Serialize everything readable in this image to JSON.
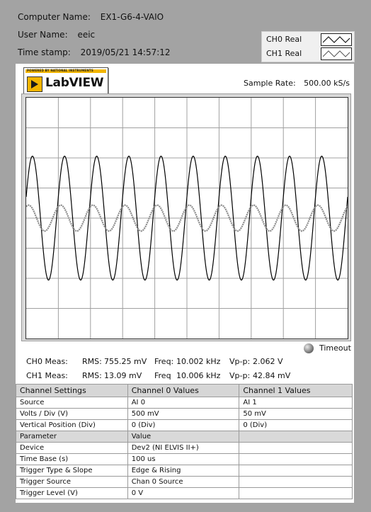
{
  "info": {
    "computer_label": "Computer Name:",
    "computer_value": "EX1-G6-4-VAIO",
    "user_label": "User Name:",
    "user_value": "eeic",
    "time_label": "Time stamp:",
    "time_value": "2019/05/21 14:57:12"
  },
  "legend": {
    "ch0": "CH0 Real",
    "ch1": "CH1 Real"
  },
  "logo": {
    "text": "LabVIEW",
    "powered": "POWERED BY NATIONAL INSTRUMENTS"
  },
  "sample_rate": {
    "label": "Sample Rate:",
    "value": "500.00 kS/s"
  },
  "timeout": {
    "label": "Timeout"
  },
  "measurements": [
    {
      "label": "CH0 Meas:",
      "rms_label": "RMS:",
      "rms": "755.25 mV",
      "freq_label": "Freq:",
      "freq": "10.002 kHz",
      "vpp_label": "Vp-p:",
      "vpp": "2.062 V"
    },
    {
      "label": "CH1 Meas:",
      "rms_label": "RMS:",
      "rms": "13.09 mV",
      "freq_label": "Freq",
      "freq": "10.006 kHz",
      "vpp_label": "Vp-p:",
      "vpp": "42.84 mV"
    }
  ],
  "table": {
    "headers": [
      "Channel Settings",
      "Channel 0 Values",
      "Channel 1 Values"
    ],
    "rows": [
      [
        "Source",
        "AI 0",
        "AI 1"
      ],
      [
        "Volts / Div (V)",
        "500 mV",
        "50 mV"
      ],
      [
        "Vertical Position (Div)",
        "0 (Div)",
        "0 (Div)"
      ]
    ],
    "sub_headers": [
      "Parameter",
      "Value",
      ""
    ],
    "param_rows": [
      [
        "Device",
        "Dev2 (NI ELVIS II+)",
        ""
      ],
      [
        "Time Base (s)",
        "100 us",
        ""
      ],
      [
        "Trigger Type & Slope",
        "Edge & Rising",
        ""
      ],
      [
        "Trigger Source",
        "Chan 0 Source",
        ""
      ],
      [
        "Trigger Level (V)",
        "0 V",
        ""
      ]
    ]
  },
  "chart_data": {
    "type": "line",
    "grid": true,
    "x_divisions": 10,
    "y_divisions": 8,
    "series": [
      {
        "name": "CH0 Real",
        "color": "#000000",
        "amplitude_div": 2.06,
        "cycles": 10.0,
        "phase": 0.35
      },
      {
        "name": "CH1 Real",
        "color": "#8c8c8c",
        "amplitude_div": 0.43,
        "cycles": 10.0,
        "phase": 1.1
      }
    ]
  }
}
